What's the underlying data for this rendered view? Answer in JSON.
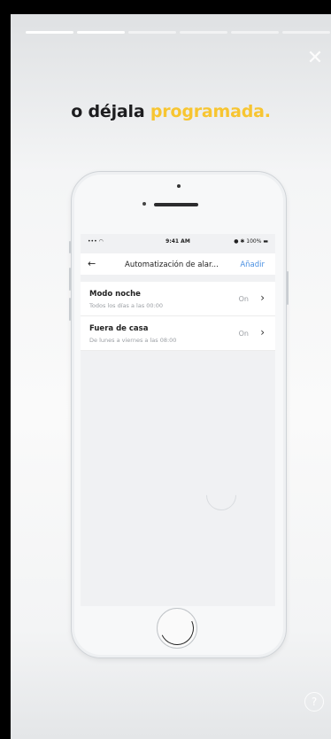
{
  "story": {
    "segments_total": 6,
    "segments_done": 2,
    "close_icon": "close-icon",
    "help_icon": "help-icon",
    "help_label": "?"
  },
  "headline": {
    "part1": "o déjala",
    "part2": "programada.",
    "accent_color": "#f7c531"
  },
  "phone": {
    "status": {
      "signal": "••• ◠",
      "time": "9:41 AM",
      "battery": "● ✱ 100% ▬"
    },
    "nav": {
      "back": "←",
      "title": "Automatización de alar...",
      "add": "Añadir"
    },
    "items": [
      {
        "title": "Modo noche",
        "subtitle": "Todos los días a las 00:00",
        "state": "On",
        "chevron": "›"
      },
      {
        "title": "Fuera de casa",
        "subtitle": "De lunes a viernes a las 08:00",
        "state": "On",
        "chevron": "›"
      }
    ]
  }
}
